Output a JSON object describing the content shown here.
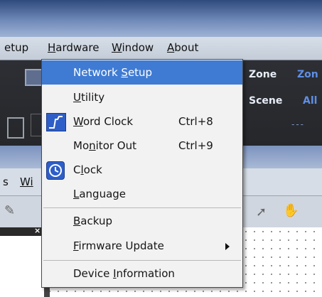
{
  "menubar": {
    "setup": "etup",
    "hardware": "ardware",
    "hardware_key": "H",
    "window": "indow",
    "window_key": "W",
    "about": "bout",
    "about_key": "A"
  },
  "panel": {
    "zone": "Zone",
    "zone2": "Zon",
    "scene": "Scene",
    "all": "All",
    "dashes": "---"
  },
  "second_window": {
    "menu_s": "s",
    "menu_wi": "Wi"
  },
  "dropdown": {
    "network_setup_pre": "Network ",
    "network_setup_key": "S",
    "network_setup_post": "etup",
    "utility_key": "U",
    "utility_post": "tility",
    "word_clock_key": "W",
    "word_clock_post": "ord Clock",
    "word_clock_shortcut": "Ctrl+8",
    "monitor_out_pre": "Mo",
    "monitor_out_key": "n",
    "monitor_out_post": "itor Out",
    "monitor_out_shortcut": "Ctrl+9",
    "clock_pre": "C",
    "clock_key": "l",
    "clock_post": "ock",
    "language_key": "L",
    "language_post": "anguage",
    "backup_key": "B",
    "backup_post": "ackup",
    "firmware_key": "F",
    "firmware_post": "irmware Update",
    "device_pre": "Device ",
    "device_key": "I",
    "device_post": "nformation"
  },
  "icons": [
    "word-clock-icon",
    "clock-icon",
    "submenu-arrow-icon"
  ],
  "colors": {
    "highlight": "#3f7bd3",
    "menu_bg": "#f2f2f2",
    "panel_bg": "#2d2f34",
    "link": "#5f8fe6"
  }
}
